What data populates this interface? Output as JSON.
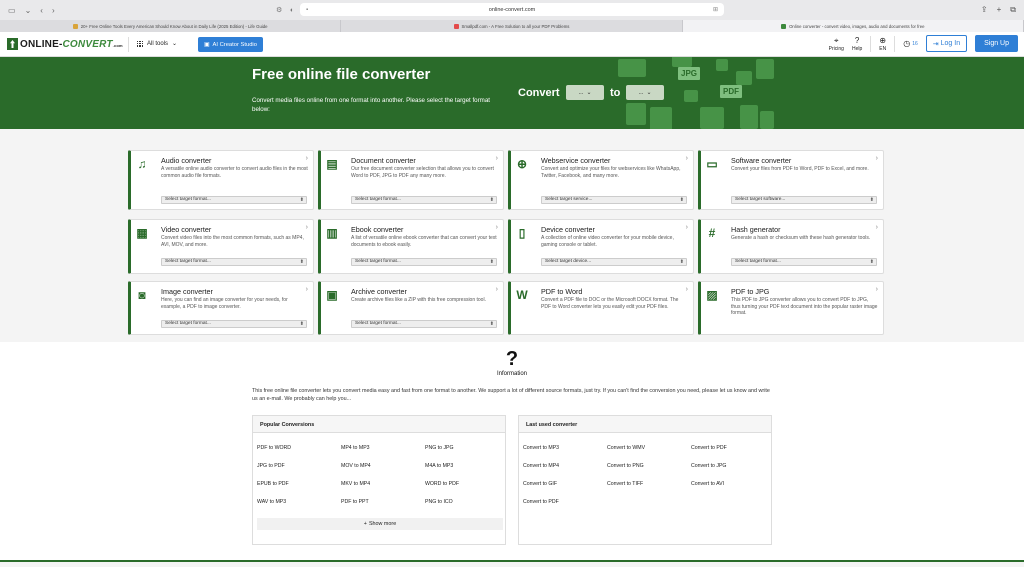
{
  "browser": {
    "url": "online-convert.com",
    "tabs": [
      {
        "title": "20+ Free Online Tools Every American Should Know About in Daily Life (2025 Edition) - Life Guide",
        "favicon_color": "#d9a43a"
      },
      {
        "title": "Smallpdf.com - A Free Solution to all your PDF Problems",
        "favicon_color": "#e34b4b"
      },
      {
        "title": "Online converter - convert video, images, audio and documents for free",
        "favicon_color": "#3d8a3d"
      }
    ]
  },
  "header": {
    "logo_main": "ONLINE-",
    "logo_accent": "CONVERT",
    "logo_suffix": ".com",
    "all_tools": "All tools",
    "ai_button": "AI Creator Studio",
    "pricing": "Pricing",
    "help": "Help",
    "language": "EN",
    "badge_count": "16",
    "login": "Log In",
    "signup": "Sign Up"
  },
  "hero": {
    "title": "Free online file converter",
    "subtitle": "Convert media files online from one format into another. Please select the target format below:",
    "convert_label": "Convert",
    "to_label": "to",
    "from_select": "...",
    "to_select": "...",
    "deco_jpg": "JPG",
    "deco_pdf": "PDF",
    "colors": {
      "green": "#2a6b2a"
    }
  },
  "cards": [
    {
      "title": "Audio converter",
      "desc": "A versatile online audio converter to convert audio files in the most common audio file formats.",
      "select": "Select target format...",
      "icon": "music-note-icon",
      "glyph": "♫"
    },
    {
      "title": "Document converter",
      "desc": "Our free document converter selection that allows you to convert Word to PDF, JPG to PDF any many more.",
      "select": "Select target format...",
      "icon": "document-icon",
      "glyph": "▤"
    },
    {
      "title": "Webservice converter",
      "desc": "Convert and optimize your files for webservices like WhatsApp, Twitter, Facebook, and many more.",
      "select": "Select target service...",
      "icon": "globe-icon",
      "glyph": "⊕"
    },
    {
      "title": "Software converter",
      "desc": "Convert your files from PDF to Word, PDF to Excel, and more.",
      "select": "Select target software...",
      "icon": "monitor-icon",
      "glyph": "▭"
    },
    {
      "title": "Video converter",
      "desc": "Convert video files into the most common formats, such as MP4, AVI, MOV, and more.",
      "select": "Select target format...",
      "icon": "film-icon",
      "glyph": "▦"
    },
    {
      "title": "Ebook converter",
      "desc": "A list of versatile online ebook converter that can convert your text documents to ebook easily.",
      "select": "Select target format...",
      "icon": "books-icon",
      "glyph": "▥"
    },
    {
      "title": "Device converter",
      "desc": "A collection of online video converter for your mobile device, gaming console or tablet.",
      "select": "Select target device...",
      "icon": "tablet-icon",
      "glyph": "▯"
    },
    {
      "title": "Hash generator",
      "desc": "Generate a hash or checksum with these hash generator tools.",
      "select": "Select target format...",
      "icon": "hash-icon",
      "glyph": "#"
    },
    {
      "title": "Image converter",
      "desc": "Here, you can find an image converter for your needs, for example, a PDF to image converter.",
      "select": "Select target format...",
      "icon": "image-icon",
      "glyph": "◙"
    },
    {
      "title": "Archive converter",
      "desc": "Create archive files like a ZIP with this free compression tool.",
      "select": "Select target format...",
      "icon": "archive-icon",
      "glyph": "▣"
    },
    {
      "title": "PDF to Word",
      "desc": "Convert a PDF file to DOC or the Microsoft DOCX format. The PDF to Word converter lets you easily edit your PDF files.",
      "select": "",
      "icon": "word-file-icon",
      "glyph": "W"
    },
    {
      "title": "PDF to JPG",
      "desc": "This PDF to JPG converter allows you to convert PDF to JPG, thus turning your PDF text document into the popular raster image format.",
      "select": "",
      "icon": "jpg-file-icon",
      "glyph": "▨"
    }
  ],
  "info": {
    "title": "Information",
    "text": "This free online file converter lets you convert media easy and fast from one format to another. We support a lot of different source formats, just try. If you can't find the conversion you need, please let us know and write us an e-mail. We probably can help you...",
    "popular": {
      "heading": "Popular Conversions",
      "items": [
        "PDF to WORD",
        "MP4 to MP3",
        "PNG to JPG",
        "JPG to PDF",
        "MOV to MP4",
        "M4A to MP3",
        "EPUB to PDF",
        "MKV to MP4",
        "WORD to PDF",
        "WAV to MP3",
        "PDF to PPT",
        "PNG to ICO"
      ],
      "show_more": "Show more"
    },
    "last_used": {
      "heading": "Last used converter",
      "items": [
        "Convert to MP3",
        "Convert to WMV",
        "Convert to PDF",
        "Convert to MP4",
        "Convert to PNG",
        "Convert to JPG",
        "Convert to GIF",
        "Convert to TIFF",
        "Convert to AVI",
        "Convert to PDF"
      ]
    }
  }
}
